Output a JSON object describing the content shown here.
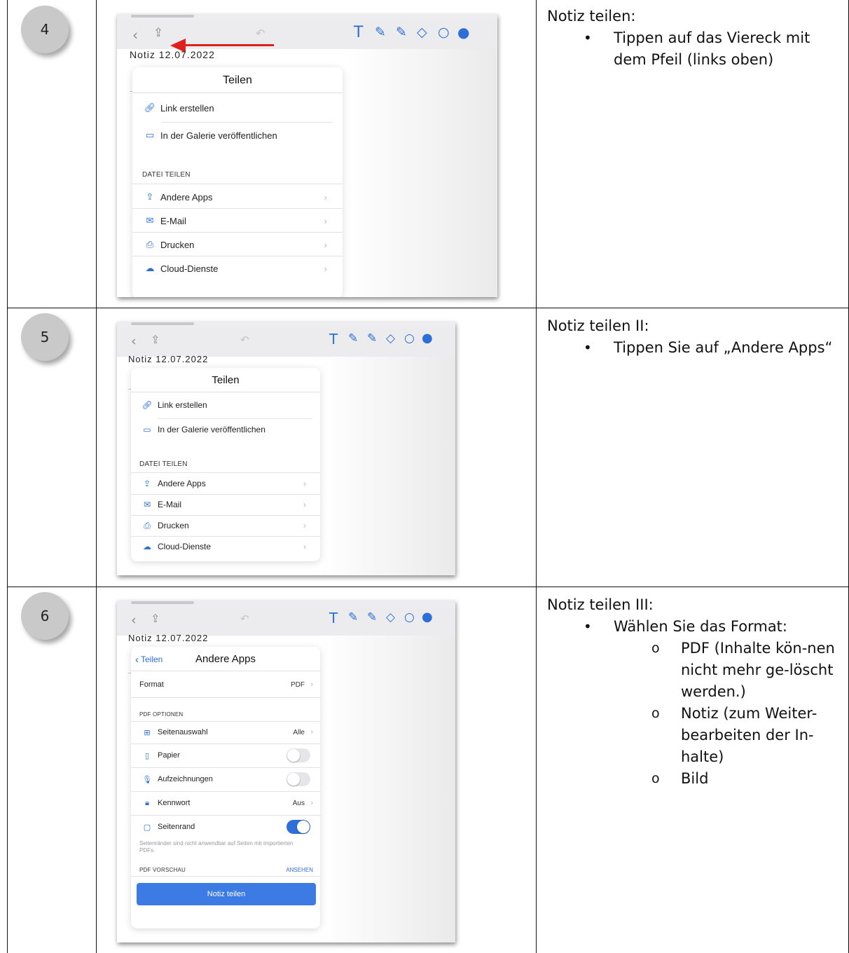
{
  "rows": [
    {
      "number": "4",
      "title": "Notiz teilen:",
      "bullets": [
        "Tippen auf das Viereck mit dem Pfeil (links oben)"
      ]
    },
    {
      "number": "5",
      "title": "Notiz teilen II:",
      "bullets": [
        "Tippen Sie auf „Andere Apps“"
      ]
    },
    {
      "number": "6",
      "title": "Notiz teilen III:",
      "bullets": [
        "Wählen Sie das Format:"
      ],
      "subbullets": [
        "PDF (Inhalte kön-nen nicht mehr ge-löscht werden.)",
        "Notiz (zum Weiter-bearbeiten der In-halte)",
        "Bild"
      ]
    }
  ],
  "share_popover": {
    "title": "Teilen",
    "items": [
      "Link erstellen",
      "In der Galerie veröffentlichen"
    ],
    "section": "DATEI TEILEN",
    "file_items": [
      "Andere Apps",
      "E-Mail",
      "Drucken",
      "Cloud-Dienste"
    ]
  },
  "note_title_fragment": "Notiz 12.07.2022",
  "apps_popover": {
    "back": "Teilen",
    "title": "Andere Apps",
    "format_label": "Format",
    "format_value": "PDF",
    "section": "PDF OPTIONEN",
    "options": [
      {
        "label": "Seitenauswahl",
        "value": "Alle"
      },
      {
        "label": "Papier",
        "toggle": false
      },
      {
        "label": "Aufzeichnungen",
        "toggle": false
      },
      {
        "label": "Kennwort",
        "value": "Aus"
      },
      {
        "label": "Seitenrand",
        "toggle": true
      }
    ],
    "hint": "Seitenränder sind nicht anwendbar auf Seiten mit importierten PDFs.",
    "preview_label": "PDF VORSCHAU",
    "preview_action": "ANSEHEN",
    "button": "Notiz teilen"
  }
}
